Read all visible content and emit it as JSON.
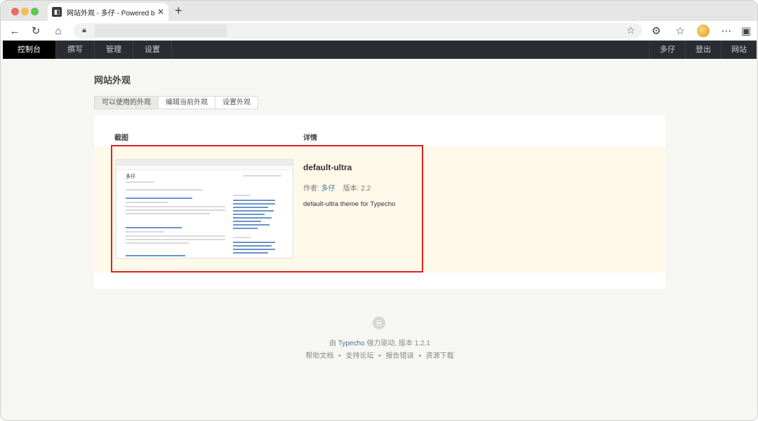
{
  "browser": {
    "tab_title": "网站外观 - 多仔 - Powered by Ty",
    "tab_close": "✕",
    "new_tab": "+",
    "url": ""
  },
  "admin_nav": {
    "left": [
      "控制台",
      "撰写",
      "管理",
      "设置"
    ],
    "right": [
      "多仔",
      "登出",
      "网站"
    ]
  },
  "page": {
    "title": "网站外观",
    "tabs": [
      "可以使用的外观",
      "编辑当前外观",
      "设置外观"
    ]
  },
  "table": {
    "col_screenshot": "截图",
    "col_details": "详情"
  },
  "theme": {
    "name": "default-ultra",
    "author_label": "作者:",
    "author": "多仔",
    "version_label": "版本:",
    "version": "2.2",
    "description": "default-ultra theme for Typecho"
  },
  "mini_preview": {
    "site_title": "多仔"
  },
  "footer": {
    "prefix": "由",
    "brand": "Typecho",
    "suffix": "强力驱动, 版本 1.2.1",
    "links": [
      "帮助文档",
      "支持论坛",
      "报告错误",
      "资源下载"
    ],
    "separator": "•"
  },
  "colors": {
    "adminbar": "#292d33",
    "link": "#467b96",
    "highlight_row": "#fff9e9",
    "annotation_border": "#e02020"
  }
}
